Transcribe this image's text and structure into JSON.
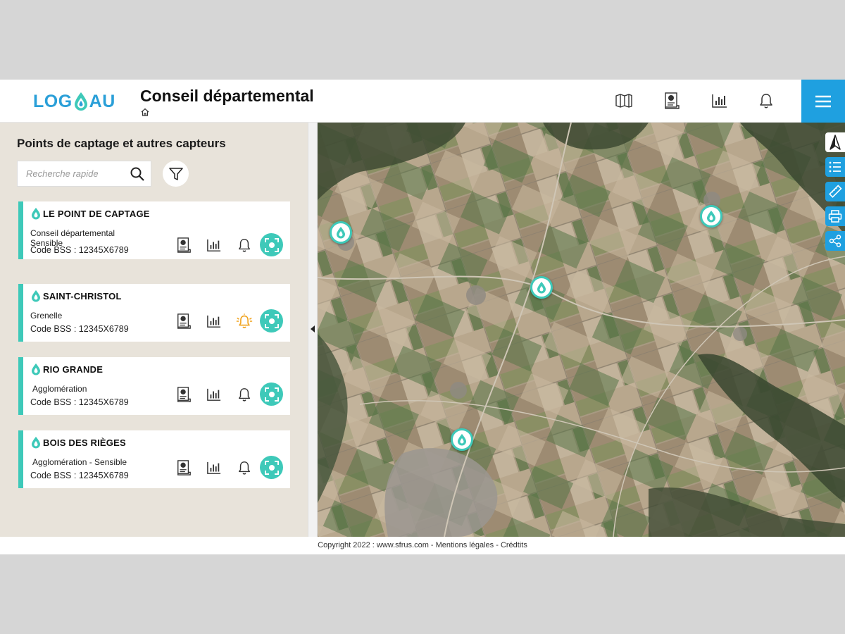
{
  "header": {
    "logo_left": "LOG",
    "logo_right": "AU",
    "title": "Conseil départemental"
  },
  "sidebar": {
    "title": "Points de captage et autres capteurs",
    "search_placeholder": "Recherche rapide",
    "items": [
      {
        "name": "LE POINT DE CAPTAGE",
        "line1": "Conseil départemental",
        "line2": "Sensible",
        "code": "Code BSS : 12345X6789",
        "alert_active": false
      },
      {
        "name": "SAINT-CHRISTOL",
        "line1": "Grenelle",
        "line2": "",
        "code": "Code BSS : 12345X6789",
        "alert_active": true
      },
      {
        "name": "RIO GRANDE",
        "line1": "Agglomération",
        "line2": "",
        "code": "Code BSS : 12345X6789",
        "alert_active": false
      },
      {
        "name": "BOIS DES RIÈGES",
        "line1": "Agglomération - Sensible",
        "line2": "",
        "code": "Code BSS : 12345X6789",
        "alert_active": false
      }
    ]
  },
  "map_tools": [
    "north-arrow",
    "layers",
    "ruler",
    "print",
    "share"
  ],
  "colors": {
    "accent": "#3ec9b9",
    "brand_blue": "#1fa0e0",
    "alert": "#f0a21c",
    "panel": "#e8e3da"
  },
  "footer": {
    "text": "Copyright 2022 : www.sfrus.com -  Mentions légales - Crédtits"
  }
}
